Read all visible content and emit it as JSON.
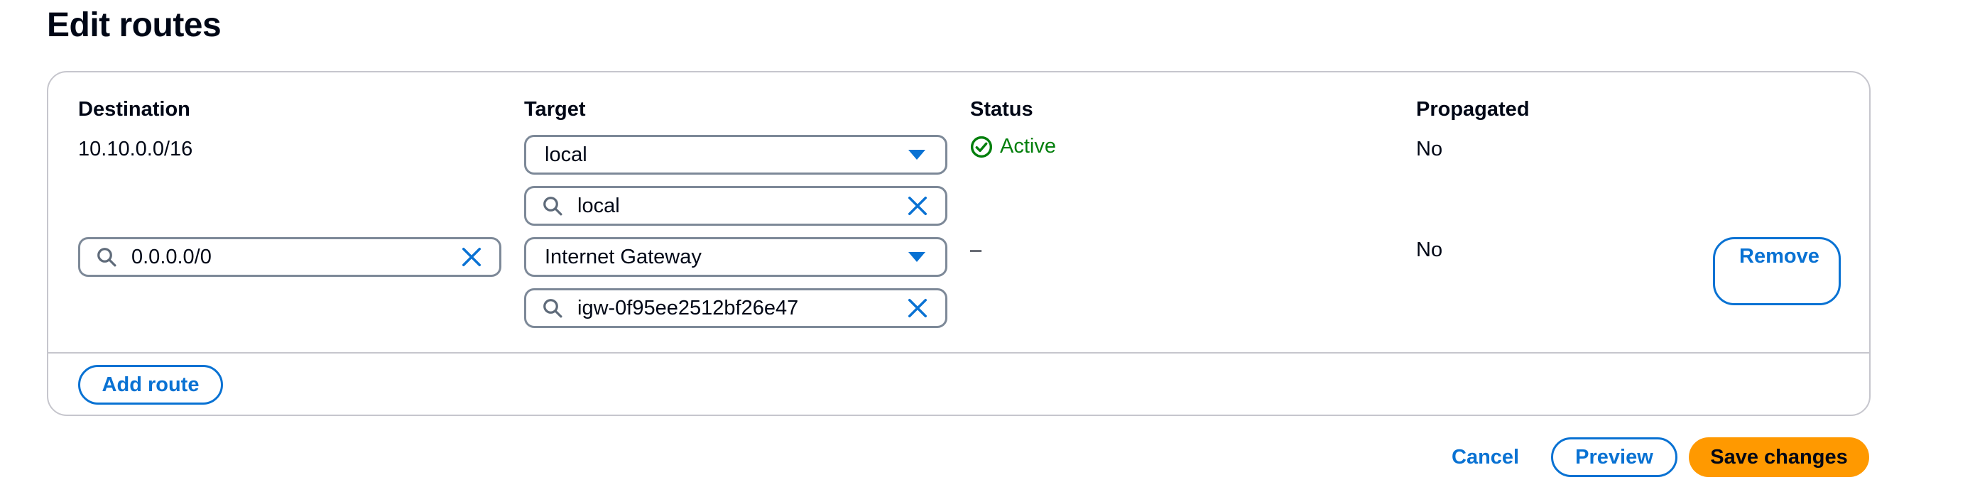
{
  "page": {
    "title": "Edit routes"
  },
  "columns": {
    "destination": "Destination",
    "target": "Target",
    "status": "Status",
    "propagated": "Propagated"
  },
  "routes": [
    {
      "destination": "10.10.0.0/16",
      "target_selected": "local",
      "target_search_value": "local",
      "status": "Active",
      "status_icon": "check-circle-icon",
      "propagated": "No"
    },
    {
      "destination_search_value": "0.0.0.0/0",
      "target_selected": "Internet Gateway",
      "target_search_value": "igw-0f95ee2512bf26e47",
      "status": "–",
      "propagated": "No",
      "remove_label": "Remove"
    }
  ],
  "actions": {
    "add_route": "Add route",
    "cancel": "Cancel",
    "preview": "Preview",
    "save": "Save changes"
  },
  "colors": {
    "accent": "#0972d3",
    "success": "#037f0c",
    "primary_button": "#ff9900",
    "border": "#c6c6cd"
  }
}
